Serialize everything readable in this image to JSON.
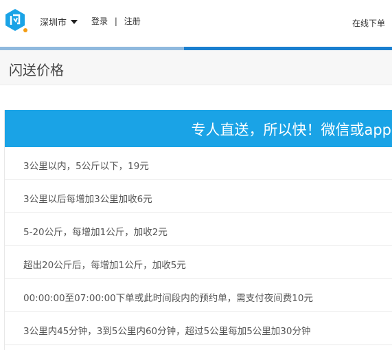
{
  "header": {
    "city": "深圳市",
    "login": "登录",
    "separator": "|",
    "register": "注册",
    "order_online": "在线下单"
  },
  "progress": {
    "fraction": 0.47
  },
  "page_title": "闪送价格",
  "banner": "专人直送，所以快！微信或app",
  "price_rules": [
    "3公里以内，5公斤以下，19元",
    "3公里以后每增加3公里加收6元",
    "5-20公斤，每增加1公斤，加收2元",
    "超出20公斤后，每增加1公斤，加收5元",
    "00:00:00至07:00:00下单或此时间段内的预约单，需支付夜间费10元",
    "3公里内45分钟，3到5公里内60分钟，超过5公里每加5公里加30分钟"
  ],
  "colors": {
    "brand_blue": "#1aa3e6",
    "bar_blue": "#1a7fcf",
    "bar_light": "#8fb9de",
    "logo_dot": "#f39c12"
  }
}
